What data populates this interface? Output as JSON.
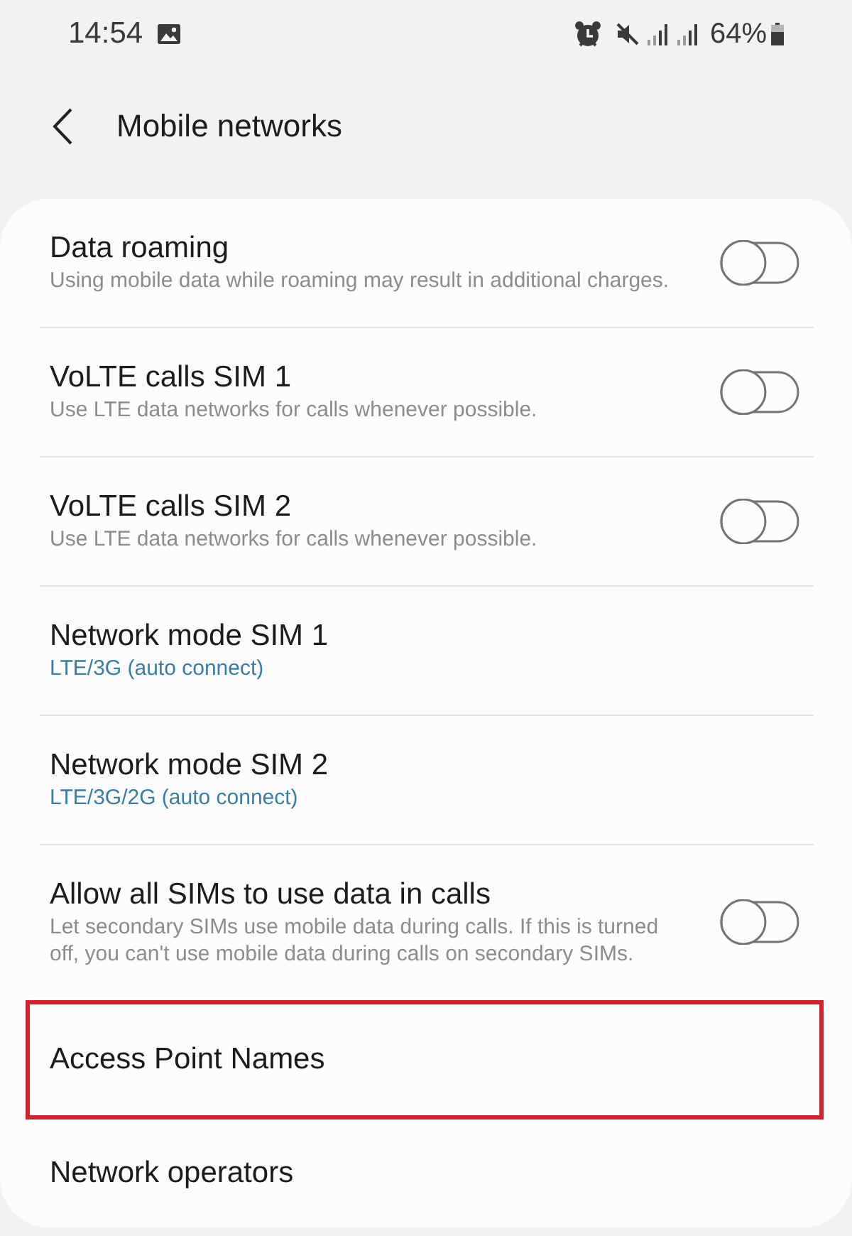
{
  "status_bar": {
    "time": "14:54",
    "battery": "64%"
  },
  "header": {
    "title": "Mobile networks"
  },
  "settings": [
    {
      "kind": "toggle",
      "title": "Data roaming",
      "description": "Using mobile data while roaming may result in additional charges.",
      "on": false,
      "highlighted": false
    },
    {
      "kind": "toggle",
      "title": "VoLTE calls SIM 1",
      "description": "Use LTE data networks for calls whenever possible.",
      "on": false,
      "highlighted": false
    },
    {
      "kind": "toggle",
      "title": "VoLTE calls SIM 2",
      "description": "Use LTE data networks for calls whenever possible.",
      "on": false,
      "highlighted": false
    },
    {
      "kind": "choice",
      "title": "Network mode SIM 1",
      "value": "LTE/3G (auto connect)",
      "highlighted": false
    },
    {
      "kind": "choice",
      "title": "Network mode SIM 2",
      "value": "LTE/3G/2G (auto connect)",
      "highlighted": false
    },
    {
      "kind": "toggle",
      "title": "Allow all SIMs to use data in calls",
      "description": "Let secondary SIMs use mobile data during calls. If this is turned off, you can't use mobile data during calls on secondary SIMs.",
      "on": false,
      "highlighted": false
    },
    {
      "kind": "link",
      "title": "Access Point Names",
      "highlighted": true
    },
    {
      "kind": "link",
      "title": "Network operators",
      "highlighted": false
    }
  ]
}
